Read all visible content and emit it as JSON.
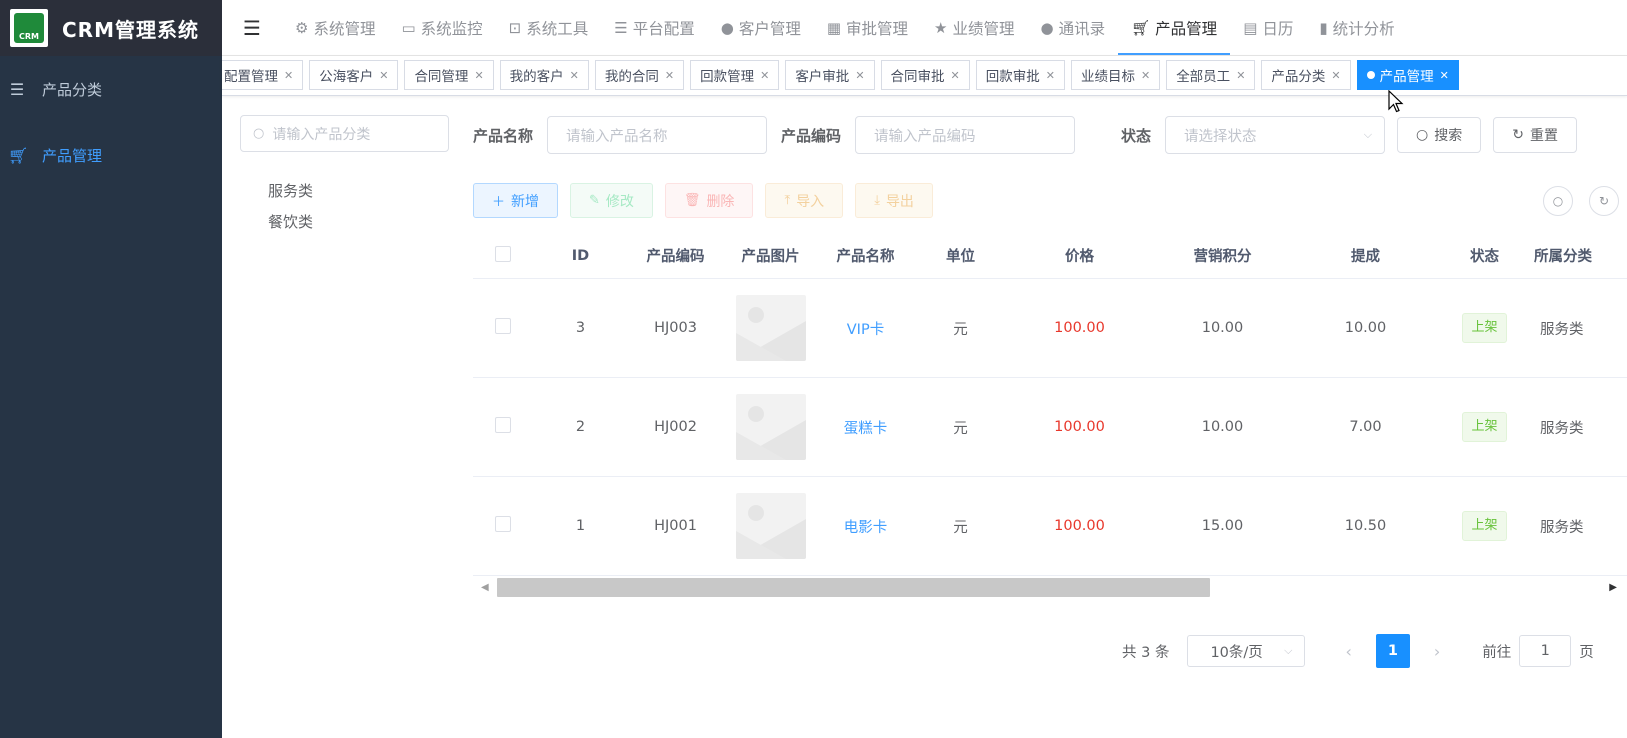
{
  "app": {
    "title": "CRM管理系统",
    "logo_text": "CRM"
  },
  "sidebar": {
    "items": [
      {
        "label": "产品分类",
        "icon": "list-icon",
        "active": false
      },
      {
        "label": "产品管理",
        "icon": "cart-icon",
        "active": true
      }
    ]
  },
  "topnav": {
    "items": [
      {
        "label": "系统管理",
        "icon": "gear-icon"
      },
      {
        "label": "系统监控",
        "icon": "monitor-icon"
      },
      {
        "label": "系统工具",
        "icon": "toolbox-icon"
      },
      {
        "label": "平台配置",
        "icon": "list-icon"
      },
      {
        "label": "客户管理",
        "icon": "user-icon"
      },
      {
        "label": "审批管理",
        "icon": "table-icon"
      },
      {
        "label": "业绩管理",
        "icon": "star-icon"
      },
      {
        "label": "通讯录",
        "icon": "user-icon"
      },
      {
        "label": "产品管理",
        "icon": "cart-icon",
        "active": true
      },
      {
        "label": "日历",
        "icon": "calendar-icon"
      },
      {
        "label": "统计分析",
        "icon": "chart-icon"
      }
    ]
  },
  "tags": [
    "配置管理",
    "公海客户",
    "合同管理",
    "我的客户",
    "我的合同",
    "回款管理",
    "客户审批",
    "合同审批",
    "回款审批",
    "业绩目标",
    "全部员工",
    "产品分类",
    "产品管理"
  ],
  "tree": {
    "search_placeholder": "请输入产品分类",
    "nodes": [
      "服务类",
      "餐饮类"
    ]
  },
  "query": {
    "name_label": "产品名称",
    "name_placeholder": "请输入产品名称",
    "code_label": "产品编码",
    "code_placeholder": "请输入产品编码",
    "status_label": "状态",
    "status_placeholder": "请选择状态",
    "search_button": "搜索",
    "reset_button": "重置"
  },
  "toolbar": {
    "add": "新增",
    "edit": "修改",
    "delete": "删除",
    "import": "导入",
    "export": "导出"
  },
  "table": {
    "columns": [
      "ID",
      "产品编码",
      "产品图片",
      "产品名称",
      "单位",
      "价格",
      "营销积分",
      "提成",
      "状态",
      "所属分类"
    ],
    "rows": [
      {
        "id": "3",
        "code": "HJ003",
        "name": "VIP卡",
        "unit": "元",
        "price": "100.00",
        "points": "10.00",
        "commission": "10.00",
        "status": "上架",
        "category": "服务类"
      },
      {
        "id": "2",
        "code": "HJ002",
        "name": "蛋糕卡",
        "unit": "元",
        "price": "100.00",
        "points": "10.00",
        "commission": "7.00",
        "status": "上架",
        "category": "服务类"
      },
      {
        "id": "1",
        "code": "HJ001",
        "name": "电影卡",
        "unit": "元",
        "price": "100.00",
        "points": "15.00",
        "commission": "10.50",
        "status": "上架",
        "category": "服务类"
      }
    ]
  },
  "pagination": {
    "total": "共 3 条",
    "page_size": "10条/页",
    "current": "1",
    "goto_label": "前往",
    "goto_value": "1",
    "page_suffix": "页"
  },
  "colors": {
    "primary": "#1890ff",
    "sidebar_bg": "#263445",
    "price": "#e8382c",
    "status_green": "#67c23a"
  }
}
